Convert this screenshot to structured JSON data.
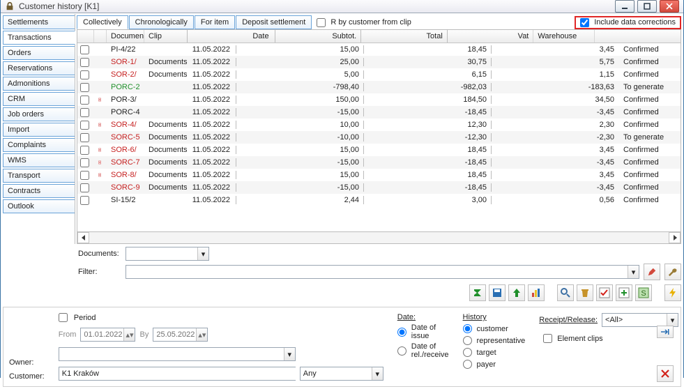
{
  "window": {
    "title": "Customer history [K1]"
  },
  "vtabs": [
    "Settlements",
    "Transactions",
    "Orders",
    "Reservations",
    "Admonitions",
    "CRM",
    "Job orders",
    "Import",
    "Complaints",
    "WMS",
    "Transport",
    "Contracts",
    "Outlook"
  ],
  "vtab_active_index": 1,
  "htabs": [
    "Collectively",
    "Chronologically",
    "For item",
    "Deposit settlement"
  ],
  "htab_active_index": 0,
  "top_checkbox": {
    "label": "R by customer from clip",
    "checked": false
  },
  "include_corrections": {
    "label": "Include data corrections",
    "checked": true
  },
  "grid": {
    "headers": [
      "",
      "",
      "Document",
      "Clip",
      "Date",
      "Subtot.",
      "Total",
      "Vat",
      "Warehouse"
    ],
    "rows": [
      {
        "icon": "",
        "doc": "PI-4/22",
        "docColor": "black",
        "clip": "",
        "date": "11.05.2022",
        "sub": "15,00",
        "tot": "18,45",
        "vat": "3,45",
        "wh": "Confirmed"
      },
      {
        "icon": "",
        "doc": "SOR-1/",
        "docColor": "red",
        "clip": "Documents",
        "date": "11.05.2022",
        "sub": "25,00",
        "tot": "30,75",
        "vat": "5,75",
        "wh": "Confirmed"
      },
      {
        "icon": "",
        "doc": "SOR-2/",
        "docColor": "red",
        "clip": "Documents",
        "date": "11.05.2022",
        "sub": "5,00",
        "tot": "6,15",
        "vat": "1,15",
        "wh": "Confirmed"
      },
      {
        "icon": "",
        "doc": "PORC-2",
        "docColor": "green",
        "clip": "",
        "date": "11.05.2022",
        "sub": "-798,40",
        "tot": "-982,03",
        "vat": "-183,63",
        "wh": "To generate"
      },
      {
        "icon": "doc",
        "doc": "POR-3/",
        "docColor": "black",
        "clip": "",
        "date": "11.05.2022",
        "sub": "150,00",
        "tot": "184,50",
        "vat": "34,50",
        "wh": "Confirmed"
      },
      {
        "icon": "",
        "doc": "PORC-4",
        "docColor": "black",
        "clip": "",
        "date": "11.05.2022",
        "sub": "-15,00",
        "tot": "-18,45",
        "vat": "-3,45",
        "wh": "Confirmed"
      },
      {
        "icon": "doc",
        "doc": "SOR-4/",
        "docColor": "red",
        "clip": "Documents",
        "date": "11.05.2022",
        "sub": "10,00",
        "tot": "12,30",
        "vat": "2,30",
        "wh": "Confirmed"
      },
      {
        "icon": "",
        "doc": "SORC-5",
        "docColor": "red",
        "clip": "Documents",
        "date": "11.05.2022",
        "sub": "-10,00",
        "tot": "-12,30",
        "vat": "-2,30",
        "wh": "To generate"
      },
      {
        "icon": "doc",
        "doc": "SOR-6/",
        "docColor": "red",
        "clip": "Documents",
        "date": "11.05.2022",
        "sub": "15,00",
        "tot": "18,45",
        "vat": "3,45",
        "wh": "Confirmed"
      },
      {
        "icon": "doc",
        "doc": "SORC-7",
        "docColor": "red",
        "clip": "Documents",
        "date": "11.05.2022",
        "sub": "-15,00",
        "tot": "-18,45",
        "vat": "-3,45",
        "wh": "Confirmed"
      },
      {
        "icon": "doc",
        "doc": "SOR-8/",
        "docColor": "red",
        "clip": "Documents",
        "date": "11.05.2022",
        "sub": "15,00",
        "tot": "18,45",
        "vat": "3,45",
        "wh": "Confirmed"
      },
      {
        "icon": "",
        "doc": "SORC-9",
        "docColor": "red",
        "clip": "Documents",
        "date": "11.05.2022",
        "sub": "-15,00",
        "tot": "-18,45",
        "vat": "-3,45",
        "wh": "Confirmed"
      },
      {
        "icon": "",
        "doc": "SI-15/2",
        "docColor": "black",
        "clip": "",
        "date": "11.05.2022",
        "sub": "2,44",
        "tot": "3,00",
        "vat": "0,56",
        "wh": "Confirmed"
      }
    ]
  },
  "documents_label": "Documents:",
  "filter_label": "Filter:",
  "toolbar_icons": [
    "sum",
    "save",
    "up",
    "bars",
    "search",
    "trash",
    "check",
    "plus",
    "s",
    "lightning"
  ],
  "lower": {
    "period_label": "Period",
    "from_label": "From",
    "from_value": "01.01.2022",
    "by_label": "By",
    "by_value": "25.05.2022",
    "owner_label": "Owner:",
    "owner_value": "",
    "customer_label": "Customer:",
    "customer_value": "K1 Kraków",
    "any_value": "Any",
    "date_label": "Date:",
    "date_radio": [
      "Date of issue",
      "Date of rel./receive"
    ],
    "date_radio_selected": 0,
    "history_label": "History",
    "history_radio": [
      "customer",
      "representative",
      "target",
      "payer"
    ],
    "history_radio_selected": 0,
    "receipt_label": "Receipt/Release:",
    "receipt_value": "<All>",
    "element_clips_label": "Element clips"
  }
}
